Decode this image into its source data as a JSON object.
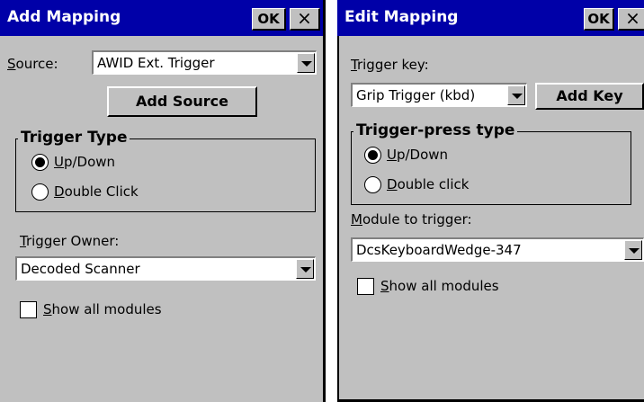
{
  "left": {
    "title": "Add Mapping",
    "ok_label": "OK",
    "close_label": "×",
    "source_label_u": "S",
    "source_label_rest": "ource:",
    "source_value": "AWID Ext. Trigger",
    "add_source_label": "Add Source",
    "group_title": "Trigger Type",
    "radio1_u": "U",
    "radio1_rest": "p/Down",
    "radio2_u": "D",
    "radio2_rest": "ouble Click",
    "owner_label_u": "T",
    "owner_label_rest": "rigger Owner:",
    "owner_value": "Decoded Scanner",
    "show_u": "S",
    "show_rest": "how all modules"
  },
  "right": {
    "title": "Edit Mapping",
    "ok_label": "OK",
    "close_label": "×",
    "trigger_key_u": "T",
    "trigger_key_rest": "rigger key:",
    "trigger_key_value": "Grip Trigger (kbd)",
    "add_key_label": "Add Key",
    "group_title": "Trigger-press type",
    "radio1_u": "U",
    "radio1_rest": "p/Down",
    "radio2_u": "D",
    "radio2_rest": "ouble click",
    "module_label_u": "M",
    "module_label_rest": "odule to trigger:",
    "module_value": "DcsKeyboardWedge-347",
    "show_u": "S",
    "show_rest": "how all modules"
  }
}
